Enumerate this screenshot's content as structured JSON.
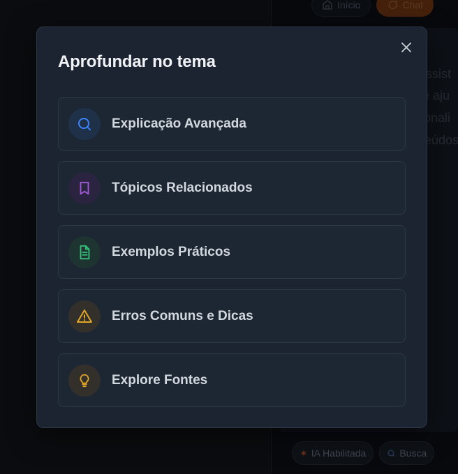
{
  "background": {
    "topbar": {
      "home_label": "Início",
      "chat_label": "Chat"
    },
    "bottom_chips": [
      {
        "label": "IA Habilitada",
        "icon": "sparkle-icon"
      },
      {
        "label": "Busca",
        "icon": "search-icon"
      }
    ],
    "faint_lines": [
      "Assist",
      "e aju",
      "onali",
      "eúdos"
    ]
  },
  "modal": {
    "title": "Aprofundar no tema",
    "close_icon": "close-icon",
    "options": [
      {
        "label": "Explicação Avançada",
        "icon": "search-icon",
        "color": "#3b82f6",
        "bg": "#1f3149"
      },
      {
        "label": "Tópicos Relacionados",
        "icon": "bookmark-icon",
        "color": "#a259d9",
        "bg": "#2b2440"
      },
      {
        "label": "Exemplos Práticos",
        "icon": "document-icon",
        "color": "#34c07a",
        "bg": "#1e3430"
      },
      {
        "label": "Erros Comuns e Dicas",
        "icon": "warning-icon",
        "color": "#e0a526",
        "bg": "#33302c"
      },
      {
        "label": "Explore Fontes",
        "icon": "lightbulb-icon",
        "color": "#e0a526",
        "bg": "#33302c"
      }
    ]
  }
}
